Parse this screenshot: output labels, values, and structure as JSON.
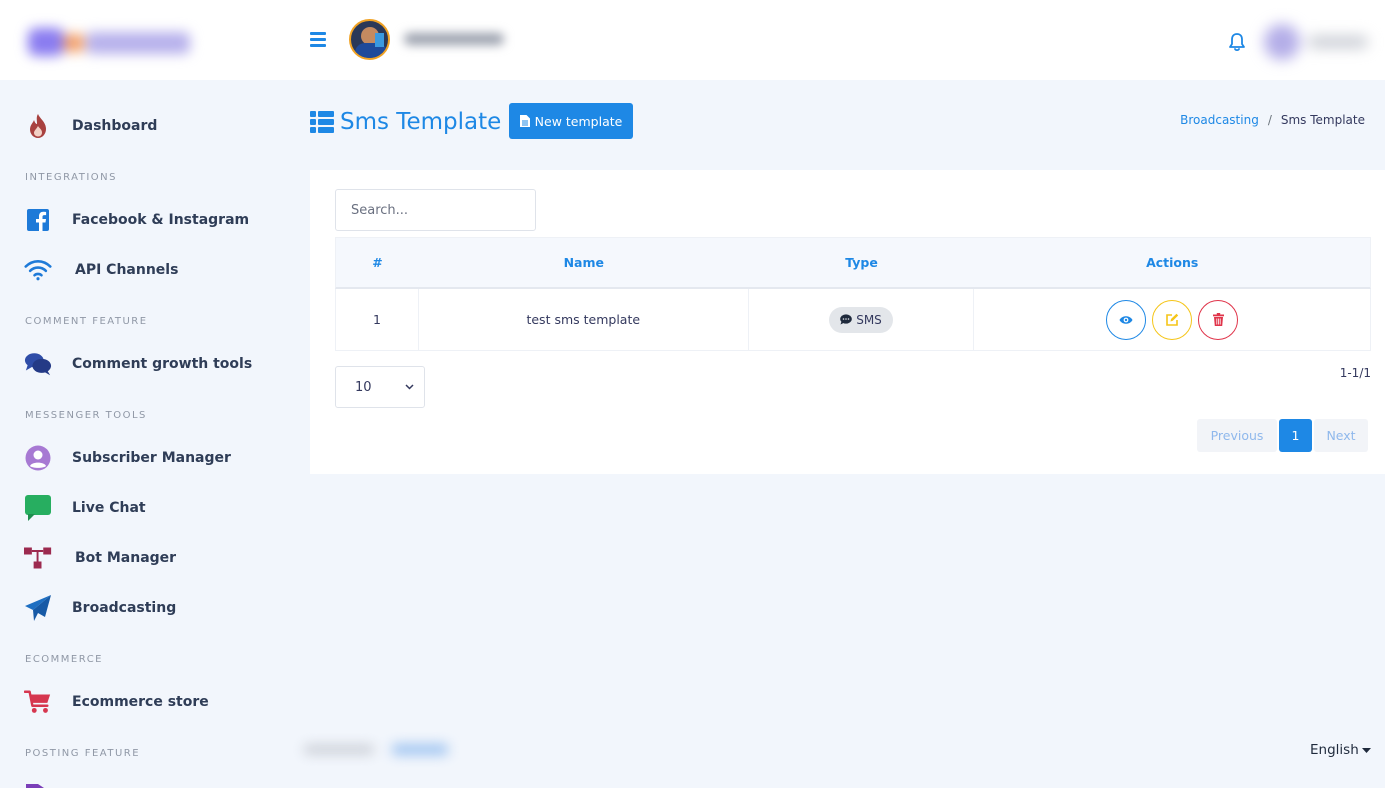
{
  "sidebar": {
    "items": [
      {
        "label": "Dashboard",
        "icon": "fire-icon"
      },
      {
        "label": "Facebook & Instagram",
        "icon": "facebook-icon"
      },
      {
        "label": "API Channels",
        "icon": "wifi-icon"
      },
      {
        "label": "Comment growth tools",
        "icon": "comments-icon"
      },
      {
        "label": "Subscriber Manager",
        "icon": "user-circle-icon"
      },
      {
        "label": "Live Chat",
        "icon": "chat-bubble-icon"
      },
      {
        "label": "Bot Manager",
        "icon": "sitemap-icon"
      },
      {
        "label": "Broadcasting",
        "icon": "paper-plane-icon"
      },
      {
        "label": "Ecommerce store",
        "icon": "cart-icon"
      }
    ],
    "headers": [
      "INTEGRATIONS",
      "COMMENT FEATURE",
      "MESSENGER TOOLS",
      "ECOMMERCE",
      "POSTING FEATURE"
    ]
  },
  "header": {
    "title": "Sms Template",
    "new_button": "New template"
  },
  "breadcrumb": {
    "parent": "Broadcasting",
    "separator": "/",
    "current": "Sms Template"
  },
  "search": {
    "placeholder": "Search..."
  },
  "table": {
    "columns": [
      "#",
      "Name",
      "Type",
      "Actions"
    ],
    "rows": [
      {
        "index": "1",
        "name": "test sms template",
        "type": "SMS"
      }
    ]
  },
  "pagination": {
    "per_page": "10",
    "range": "1-1/1",
    "previous": "Previous",
    "current_page": "1",
    "next": "Next"
  },
  "footer": {
    "language": "English"
  },
  "colors": {
    "primary": "#1e88e5",
    "warning": "#f5c518",
    "danger": "#e0344a",
    "background": "#f2f6fc"
  }
}
